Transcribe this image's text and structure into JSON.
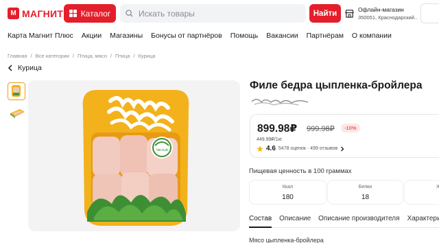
{
  "header": {
    "logo_text": "МАГНИТ",
    "catalog_label": "Каталог",
    "search_placeholder": "Искать товары",
    "find_label": "Найти",
    "store_title": "Офлайн-магазин",
    "store_address": "350051, Краснодарский…"
  },
  "nav": {
    "items": [
      "Карта Магнит Плюс",
      "Акции",
      "Магазины",
      "Бонусы от партнёров",
      "Помощь",
      "Вакансии",
      "Партнёрам",
      "О компании"
    ]
  },
  "breadcrumbs": [
    "Главная",
    "Все категории",
    "Птица, мясо",
    "Птица",
    "Курица"
  ],
  "back_label": "Курица",
  "product": {
    "title": "Филе бедра цыпленка-бройлера",
    "price": "899.98₽",
    "old_price": "999.98₽",
    "discount": "-10%",
    "unit_price": "449.99₽/1кг",
    "rating": "4.6",
    "ratings_count": "5478 оценок · 499 отзывов",
    "package_label": "Чистый продукт"
  },
  "nutrition": {
    "title": "Пищевая ценность в 100 граммах",
    "items": [
      {
        "label": "Ккал",
        "value": "180"
      },
      {
        "label": "Белки",
        "value": "18"
      },
      {
        "label": "Жи",
        "value": ""
      }
    ]
  },
  "tabs": [
    "Состав",
    "Описание",
    "Описание производителя",
    "Характери"
  ],
  "composition_text": "Мясо цыпленка-бройлера",
  "colors": {
    "brand": "#e41e2b",
    "accent": "#e4a11b"
  }
}
